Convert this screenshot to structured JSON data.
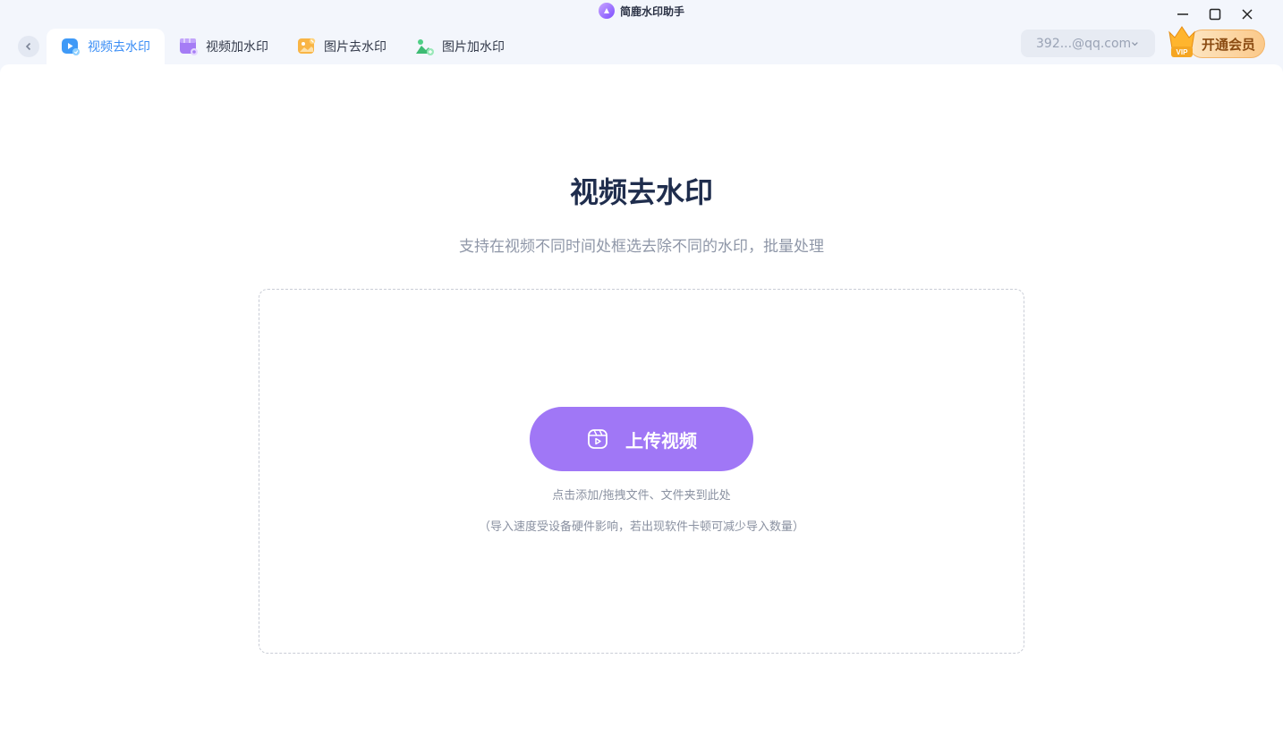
{
  "app": {
    "title": "简鹿水印助手"
  },
  "tabs": [
    {
      "label": "视频去水印",
      "active": true,
      "icon": "video-remove-icon"
    },
    {
      "label": "视频加水印",
      "active": false,
      "icon": "video-add-icon"
    },
    {
      "label": "图片去水印",
      "active": false,
      "icon": "image-remove-icon"
    },
    {
      "label": "图片加水印",
      "active": false,
      "icon": "image-add-icon"
    }
  ],
  "account": {
    "email": "392...@qq.com"
  },
  "vip": {
    "label": "开通会员",
    "badge": "VIP"
  },
  "main": {
    "title": "视频去水印",
    "subtitle": "支持在视频不同时间处框选去除不同的水印，批量处理",
    "upload_label": "上传视频",
    "hint": "点击添加/拖拽文件、文件夹到此处",
    "note": "（导入速度受设备硬件影响，若出现软件卡顿可减少导入数量）"
  },
  "colors": {
    "accent": "#3a8df5",
    "upload": "#a077f6",
    "title": "#1f2d4d",
    "vip": "#fbc98a"
  }
}
